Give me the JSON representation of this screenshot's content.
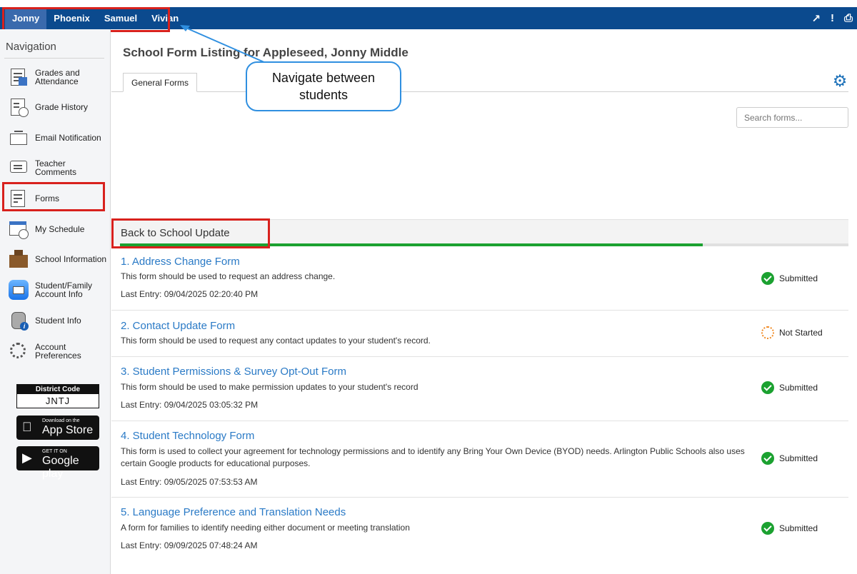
{
  "students": [
    "Jonny",
    "Phoenix",
    "Samuel",
    "Vivian"
  ],
  "active_student": "Jonny",
  "navigation": {
    "title": "Navigation",
    "items": [
      {
        "label": "Grades and Attendance",
        "icon": "gradebook-icon"
      },
      {
        "label": "Grade History",
        "icon": "grade-history-icon"
      },
      {
        "label": "Email Notification",
        "icon": "envelope-icon"
      },
      {
        "label": "Teacher Comments",
        "icon": "speech-bubble-icon"
      },
      {
        "label": "Forms",
        "icon": "forms-icon"
      },
      {
        "label": "My Schedule",
        "icon": "calendar-clock-icon"
      },
      {
        "label": "School Information",
        "icon": "school-building-icon"
      },
      {
        "label": "Student/Family Account Info",
        "icon": "mail-app-icon"
      },
      {
        "label": "Student Info",
        "icon": "backpack-info-icon"
      },
      {
        "label": "Account Preferences",
        "icon": "gear-icon"
      }
    ]
  },
  "district": {
    "header": "District Code",
    "code": "JNTJ"
  },
  "stores": {
    "app_store": {
      "small": "Download on the",
      "big": "App Store"
    },
    "google_play": {
      "small": "GET IT ON",
      "big": "Google play"
    }
  },
  "page_title": "School Form Listing for Appleseed, Jonny Middle",
  "tab_label": "General Forms",
  "search_placeholder": "Search forms...",
  "section_title": "Back to School Update",
  "section_progress": 0.8,
  "forms": [
    {
      "title": "1. Address Change Form",
      "description": "This form should be used to request an address change.",
      "last_entry": "Last Entry: 09/04/2025 02:20:40 PM",
      "status": "Submitted"
    },
    {
      "title": "2. Contact Update Form",
      "description": "This form should be used to request any contact updates to your student's record.",
      "last_entry": "",
      "status": "Not Started"
    },
    {
      "title": "3. Student Permissions & Survey Opt-Out Form",
      "description": "This form should be used to make permission updates to your student's record",
      "last_entry": "Last Entry: 09/04/2025 03:05:32 PM",
      "status": "Submitted"
    },
    {
      "title": "4. Student Technology Form",
      "description": "This form is used to collect your agreement for technology permissions and to identify any Bring Your Own Device (BYOD) needs. Arlington Public Schools also uses certain Google products for educational purposes.",
      "last_entry": "Last Entry: 09/05/2025 07:53:53 AM",
      "status": "Submitted"
    },
    {
      "title": "5. Language Preference and Translation Needs",
      "description": "A form for families to identify needing either document or meeting translation",
      "last_entry": "Last Entry: 09/09/2025 07:48:24 AM",
      "status": "Submitted"
    }
  ],
  "callout": "Navigate between students",
  "colors": {
    "topbar": "#0b4a8e",
    "link": "#2a7ac6",
    "submitted": "#1ba130",
    "not_started": "#f08a24",
    "highlight": "#d8211d"
  }
}
